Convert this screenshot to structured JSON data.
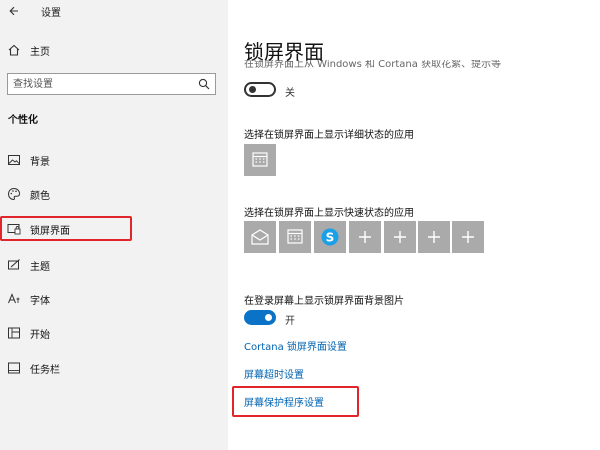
{
  "window": {
    "title": "设置"
  },
  "sidebar": {
    "home_label": "主页",
    "search_placeholder": "查找设置",
    "section_heading": "个性化",
    "items": [
      {
        "label": "背景",
        "icon": "picture-icon"
      },
      {
        "label": "颜色",
        "icon": "palette-icon"
      },
      {
        "label": "锁屏界面",
        "icon": "lock-screen-icon",
        "selected": true
      },
      {
        "label": "主题",
        "icon": "theme-icon"
      },
      {
        "label": "字体",
        "icon": "font-icon"
      },
      {
        "label": "开始",
        "icon": "start-icon"
      },
      {
        "label": "任务栏",
        "icon": "taskbar-icon"
      }
    ]
  },
  "main": {
    "title": "锁屏界面",
    "clipped_description": "在锁屏界面上从 Windows 和 Cortana 获取花絮、提示等",
    "fun_facts_toggle": {
      "state": "off",
      "label": "关"
    },
    "detailed_status_label": "选择在锁屏界面上显示详细状态的应用",
    "quick_status_label": "选择在锁屏界面上显示快速状态的应用",
    "quick_status_apps": [
      "mail-icon",
      "calendar-icon",
      "skype-icon",
      "plus-icon",
      "plus-icon",
      "plus-icon",
      "plus-icon"
    ],
    "signin_background_label": "在登录屏幕上显示锁屏界面背景图片",
    "signin_background_toggle": {
      "state": "on",
      "label": "开"
    },
    "links": {
      "cortana": "Cortana 锁屏界面设置",
      "timeout": "屏幕超时设置",
      "screensaver": "屏幕保护程序设置"
    }
  },
  "colors": {
    "accent": "#0a72c7",
    "link": "#0063b1",
    "highlight": "#e0262a",
    "sidebar_bg": "#f2f2f2",
    "tile_bg": "#aaaaaa"
  }
}
